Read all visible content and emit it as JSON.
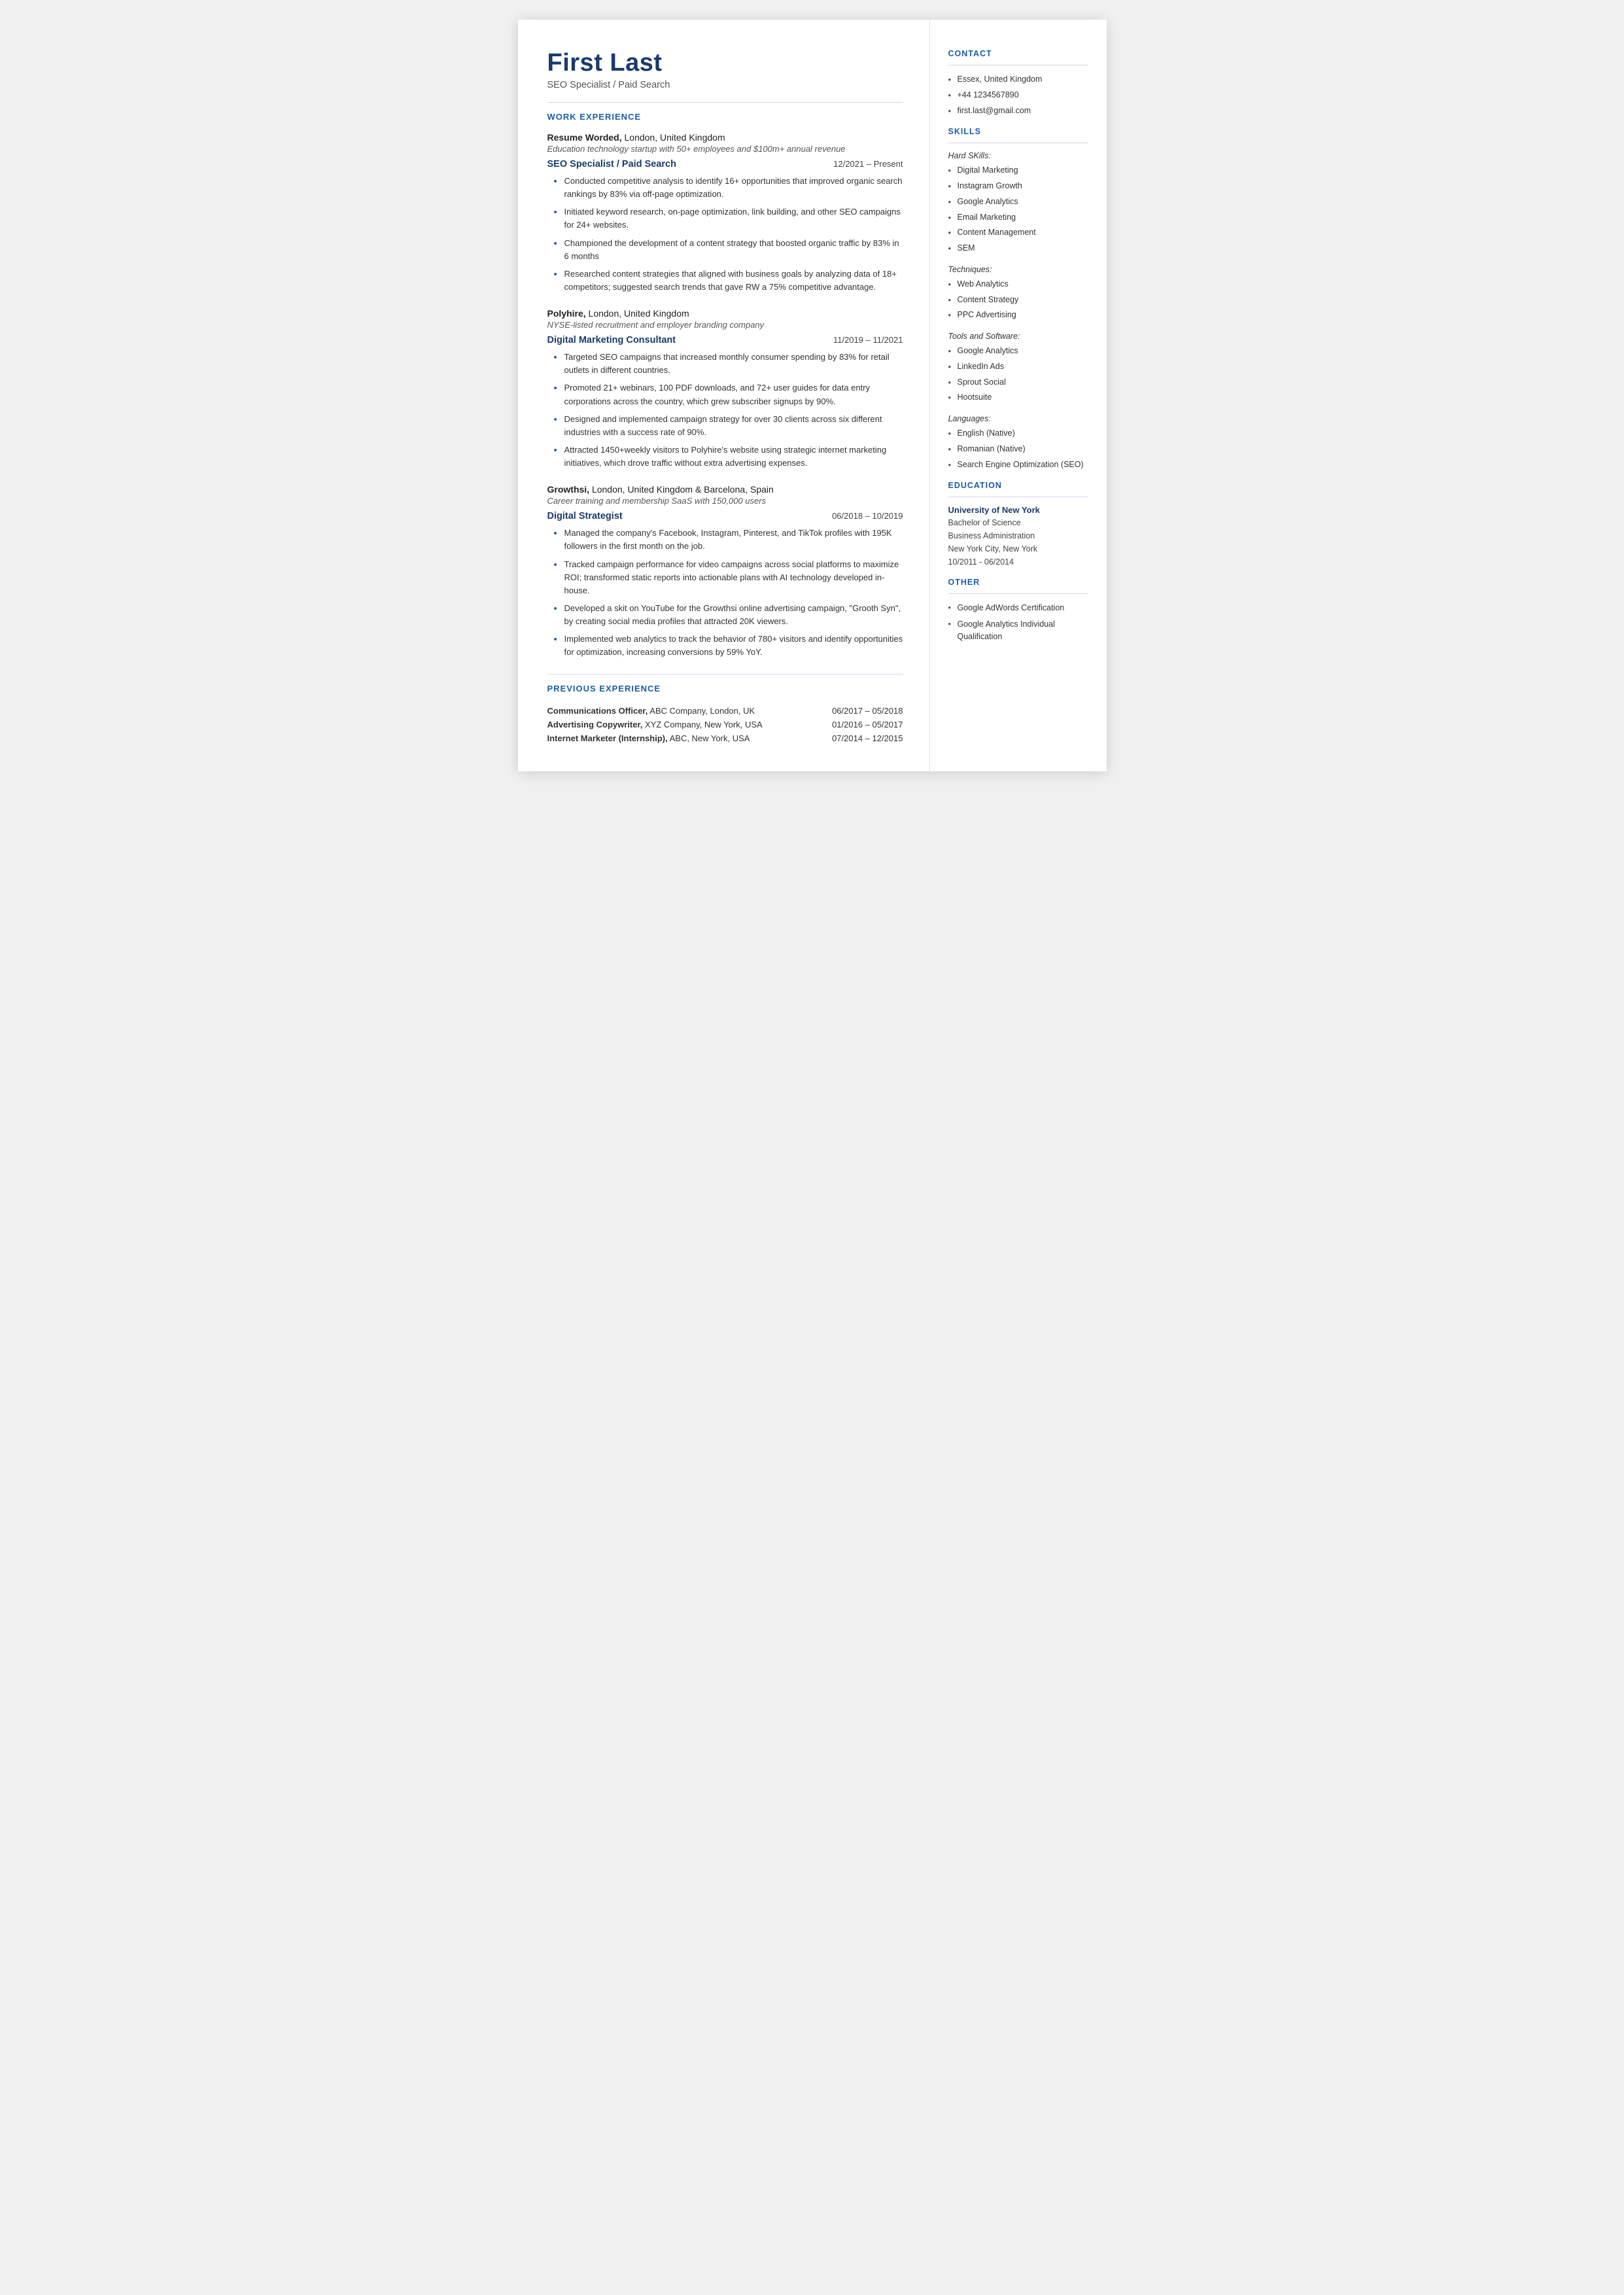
{
  "header": {
    "name": "First Last",
    "subtitle": "SEO Specialist / Paid Search"
  },
  "sections": {
    "work_experience_label": "WORK EXPERIENCE",
    "previous_experience_label": "PREVIOUS EXPERIENCE"
  },
  "work_experience": [
    {
      "company": "Resume Worded,",
      "company_rest": " London, United Kingdom",
      "company_desc": "Education technology startup with 50+ employees and $100m+ annual revenue",
      "job_title": "SEO Specialist / Paid Search",
      "dates": "12/2021 – Present",
      "bullets": [
        "Conducted competitive analysis to identify 16+ opportunities that improved organic search rankings by 83% via off-page optimization.",
        "Initiated keyword research, on-page optimization, link building, and other SEO campaigns for 24+ websites.",
        "Championed the development of a content strategy that boosted organic traffic by 83% in 6 months",
        "Researched content strategies that aligned with business goals by analyzing data of 18+ competitors; suggested search trends that gave RW a 75% competitive advantage."
      ]
    },
    {
      "company": "Polyhire,",
      "company_rest": " London, United Kingdom",
      "company_desc": "NYSE-listed recruitment and employer branding company",
      "job_title": "Digital Marketing Consultant",
      "dates": "11/2019 – 11/2021",
      "bullets": [
        "Targeted SEO campaigns that increased monthly consumer spending by 83% for retail outlets in different countries.",
        "Promoted 21+ webinars, 100 PDF downloads, and 72+ user guides for data entry corporations across the country, which grew subscriber signups by 90%.",
        "Designed and implemented campaign strategy for over 30 clients across six different industries with a success rate of 90%.",
        "Attracted 1450+weekly visitors to Polyhire's website using strategic internet marketing initiatives, which drove traffic without extra advertising expenses."
      ]
    },
    {
      "company": "Growthsi,",
      "company_rest": " London, United Kingdom & Barcelona, Spain",
      "company_desc": "Career training and membership SaaS with 150,000 users",
      "job_title": "Digital Strategist",
      "dates": "06/2018 – 10/2019",
      "bullets": [
        "Managed the company's Facebook, Instagram, Pinterest, and TikTok profiles with 195K followers in the first month on the job.",
        "Tracked campaign performance for video campaigns across social platforms to maximize ROI; transformed static reports into actionable plans with AI technology developed in-house.",
        "Developed a skit on YouTube for the Growthsi online advertising campaign, \"Grooth Syn\", by creating social media profiles that attracted 20K viewers.",
        "Implemented web analytics to track the behavior of 780+ visitors and identify opportunities for optimization, increasing conversions by 59% YoY."
      ]
    }
  ],
  "previous_experience": [
    {
      "role_bold": "Communications Officer,",
      "role_rest": " ABC Company, London, UK",
      "dates": "06/2017 – 05/2018"
    },
    {
      "role_bold": "Advertising Copywriter,",
      "role_rest": " XYZ Company, New York, USA",
      "dates": "01/2016 – 05/2017"
    },
    {
      "role_bold": "Internet Marketer (Internship),",
      "role_rest": " ABC, New York, USA",
      "dates": "07/2014 – 12/2015"
    }
  ],
  "sidebar": {
    "contact_label": "CONTACT",
    "contact_items": [
      "Essex, United Kingdom",
      "+44 1234567890",
      "first.last@gmail.com"
    ],
    "skills_label": "SKILLS",
    "hard_skills_label": "Hard SKills:",
    "hard_skills": [
      "Digital Marketing",
      "Instagram Growth",
      "Google Analytics",
      "Email Marketing",
      "Content Management",
      "SEM"
    ],
    "techniques_label": "Techniques:",
    "techniques": [
      "Web Analytics",
      "Content Strategy",
      "PPC Advertising"
    ],
    "tools_label": "Tools and Software:",
    "tools": [
      "Google Analytics",
      "LinkedIn Ads",
      "Sprout Social",
      "Hootsuite"
    ],
    "languages_label": "Languages:",
    "languages": [
      "English (Native)",
      "Romanian (Native)",
      "Search Engine Optimization (SEO)"
    ],
    "education_label": "EDUCATION",
    "education": [
      {
        "school": "University of New York",
        "degree": "Bachelor of Science",
        "field": "Business Administration",
        "location": "New York City, New York",
        "dates": "10/2011 - 06/2014"
      }
    ],
    "other_label": "OTHER",
    "other_items": [
      "Google AdWords Certification",
      "Google Analytics Individual Qualification"
    ]
  }
}
